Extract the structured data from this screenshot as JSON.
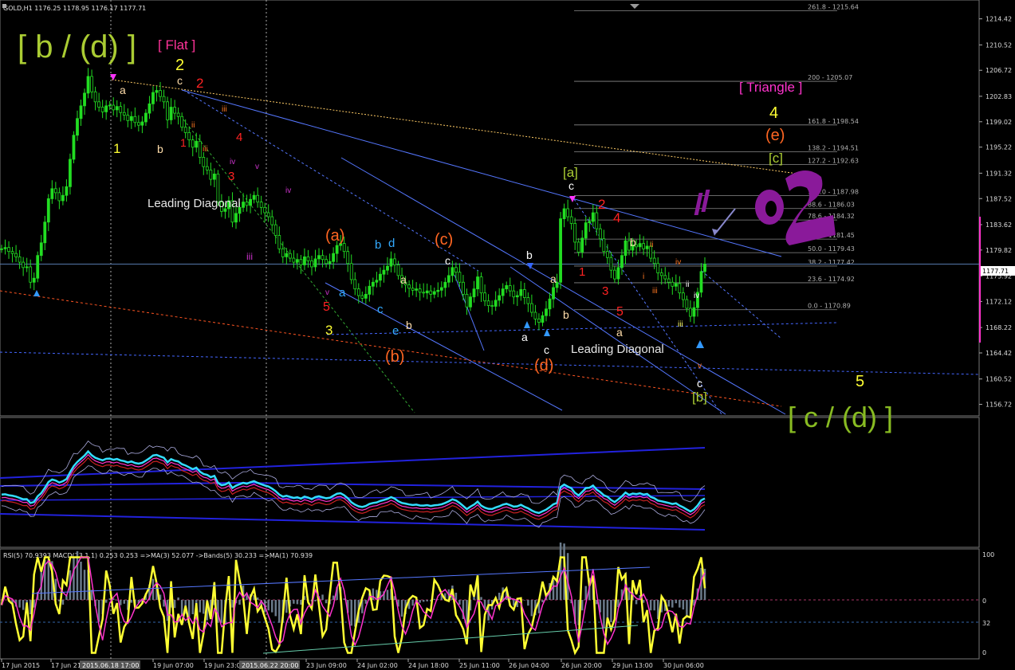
{
  "header": {
    "symbol_line": "GOLD,H1  1176.25 1178.95 1176.17 1177.71",
    "rsi_line": "RSI(5) 70.9393  MACD(13,1,1) 0.253 0.253  =>MA(3) 52.077  ->Bands(5) 30.233  =>MA(1) 70.939"
  },
  "colors": {
    "candle": "#22dd22",
    "trendline": "#5577ff",
    "fib": "#8a8a8a",
    "current_price": "#5577aa",
    "pink_axis": "#ff33cc",
    "rsi": "#ffff33",
    "ma": "#ff33cc",
    "macd_hist": "#6a7a8a"
  },
  "price_axis": {
    "ticks": [
      "1214.42",
      "1210.52",
      "1206.72",
      "1202.83",
      "1199.02",
      "1195.22",
      "1191.32",
      "1187.52",
      "1183.62",
      "1179.82",
      "1175.92",
      "1172.12",
      "1168.22",
      "1164.42",
      "1160.52",
      "1156.72"
    ],
    "current": "1177.71"
  },
  "rsi_axis": {
    "ticks": [
      "100",
      "0",
      "32",
      "0"
    ]
  },
  "time_axis": {
    "ticks": [
      "17 Jun 2015",
      "17 Jun 21:00",
      "19 Jun 07:00",
      "19 Jun 23:00",
      "23 Jun 09:00",
      "24 Jun 02:00",
      "24 Jun 18:00",
      "25 Jun 11:00",
      "26 Jun 04:00",
      "26 Jun 20:00",
      "29 Jun 13:00",
      "30 Jun 06:00"
    ],
    "highlights": [
      "2015.06.18 17:00",
      "2015.06.22 20:00"
    ]
  },
  "fib_levels": [
    "261.8 - 1215.64",
    "200 - 1205.07",
    "161.8 - 1198.54",
    "138.2 - 1194.51",
    "127.2 - 1192.63",
    "100.0 - 1187.98",
    "88.6 - 1186.03",
    "78.6 - 1184.32",
    "61.8 - 1181.45",
    "50.0 - 1179.43",
    "38.2 - 1177.42",
    "23.6 - 1174.92",
    "0.0 - 1170.89"
  ],
  "labels": {
    "big_b_d": "[ b / (d) ]",
    "flat": "[ Flat ]",
    "triangle": "[ Triangle ]",
    "big_c_d": "[ c / (d) ]",
    "leading_diagonal_1": "Leading Diagonal",
    "leading_diagonal_2": "Leading Diagonal",
    "bracket_a": "[a]",
    "bracket_b": "[b]",
    "bracket_c": "[c]",
    "paren_a": "(a)",
    "paren_b": "(b)",
    "paren_c": "(c)",
    "paren_d": "(d)",
    "paren_e": "(e)"
  },
  "wave_marks": [
    "1",
    "2",
    "3",
    "4",
    "5",
    "a",
    "b",
    "c",
    "d",
    "e",
    "i",
    "ii",
    "iii",
    "iv",
    "v"
  ],
  "chart_data": {
    "type": "candlestick",
    "symbol": "GOLD",
    "timeframe": "H1",
    "ylim": [
      1155.0,
      1217.0
    ],
    "close": [
      1180.0,
      1180.2,
      1179.6,
      1179.3,
      1178.8,
      1178.0,
      1177.2,
      1177.3,
      1175.0,
      1175.6,
      1179.0,
      1180.9,
      1184.0,
      1187.5,
      1189.0,
      1188.4,
      1187.2,
      1188.0,
      1189.3,
      1193.4,
      1197.0,
      1199.5,
      1201.4,
      1203.3,
      1205.8,
      1203.5,
      1202.0,
      1201.2,
      1200.5,
      1201.4,
      1201.5,
      1200.8,
      1201.3,
      1200.4,
      1200.0,
      1199.2,
      1199.8,
      1198.9,
      1198.5,
      1199.0,
      1200.3,
      1201.7,
      1203.4,
      1203.7,
      1202.8,
      1202.0,
      1199.3,
      1201.2,
      1200.3,
      1199.8,
      1198.2,
      1197.4,
      1196.3,
      1195.2,
      1196.1,
      1193.7,
      1192.3,
      1191.8,
      1190.4,
      1191.2,
      1187.0,
      1185.6,
      1186.0,
      1187.2,
      1184.0,
      1185.3,
      1186.2,
      1187.0,
      1186.5,
      1187.4,
      1188.0,
      1187.0,
      1186.2,
      1185.4,
      1184.8,
      1183.6,
      1182.0,
      1180.0,
      1178.8,
      1179.3,
      1178.6,
      1178.0,
      1178.4,
      1177.6,
      1178.8,
      1178.2,
      1177.3,
      1178.5,
      1179.0,
      1178.4,
      1177.8,
      1178.1,
      1179.3,
      1180.5,
      1180.8,
      1179.6,
      1177.8,
      1175.4,
      1174.0,
      1173.0,
      1172.6,
      1173.2,
      1174.4,
      1175.0,
      1175.3,
      1176.2,
      1176.8,
      1177.4,
      1178.5,
      1177.6,
      1176.0,
      1175.0,
      1174.6,
      1174.1,
      1173.8,
      1174.0,
      1173.5,
      1173.4,
      1173.7,
      1173.2,
      1173.6,
      1173.8,
      1174.2,
      1175.0,
      1176.0,
      1177.2,
      1176.5,
      1175.0,
      1173.2,
      1171.3,
      1172.8,
      1174.0,
      1175.8,
      1173.4,
      1172.2,
      1171.5,
      1171.4,
      1172.3,
      1173.0,
      1174.0,
      1174.5,
      1173.7,
      1172.8,
      1173.0,
      1173.9,
      1172.7,
      1171.8,
      1170.5,
      1169.5,
      1169.0,
      1170.0,
      1171.0,
      1172.5,
      1174.2,
      1175.0,
      1184.5,
      1186.0,
      1184.8,
      1183.8,
      1181.0,
      1179.5,
      1181.6,
      1183.9,
      1184.1,
      1185.4,
      1183.0,
      1181.5,
      1179.6,
      1178.7,
      1176.8,
      1175.5,
      1177.2,
      1179.0,
      1181.2,
      1179.8,
      1180.6,
      1180.3,
      1180.8,
      1180.0,
      1180.4,
      1178.6,
      1177.8,
      1176.4,
      1176.0,
      1175.5,
      1175.0,
      1174.4,
      1174.8,
      1173.4,
      1172.4,
      1171.1,
      1169.9,
      1171.2,
      1173.5,
      1176.6,
      1177.71
    ],
    "annotation_price_levels": {
      "wave_b_d_top": 1205.8,
      "wave_2_top": 1203.7,
      "bracket_a_top": 1187.5,
      "bracket_b_low": 1169.5
    }
  }
}
